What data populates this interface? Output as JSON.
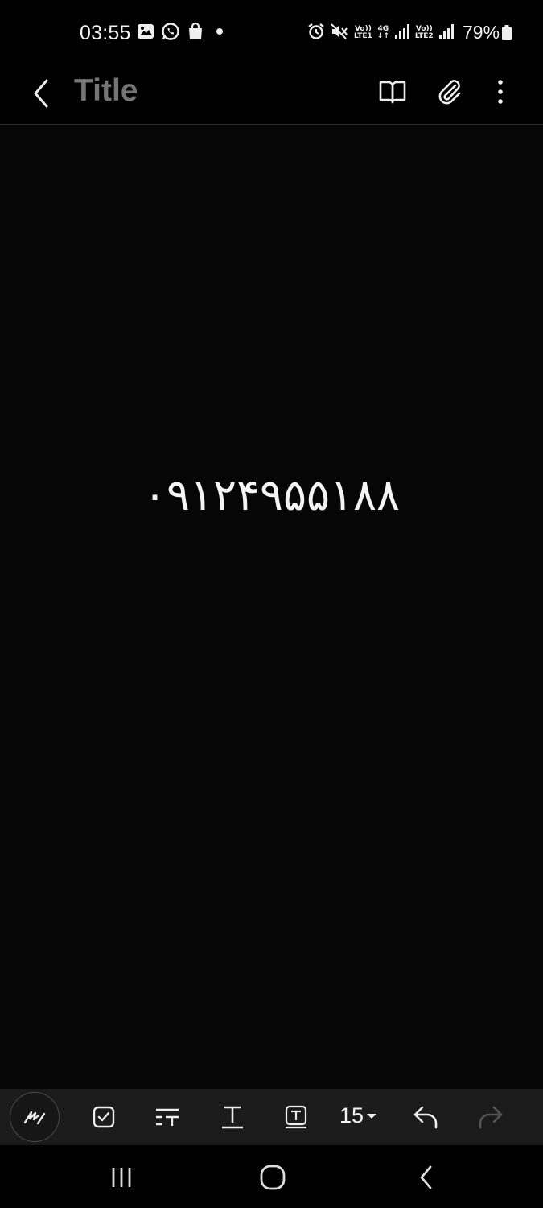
{
  "status_bar": {
    "time": "03:55",
    "left_icons": [
      "gallery-icon",
      "whatsapp-icon",
      "shopping-bag-icon",
      "notification-dot-icon"
    ],
    "right_icons": [
      "alarm-icon",
      "mute-icon",
      "volte-lte1-icon",
      "4g-icon",
      "signal-icon",
      "volte-lte2-icon",
      "signal-icon"
    ],
    "volte1_top": "Vo))",
    "volte1_bottom": "LTE1",
    "network_label": "4G",
    "volte2_top": "Vo))",
    "volte2_bottom": "LTE2",
    "battery_text": "79%"
  },
  "app_bar": {
    "title_placeholder": "Title",
    "actions": [
      "reading-mode-icon",
      "attach-icon",
      "more-options-icon"
    ]
  },
  "note": {
    "text": "۰۹۱۲۴۹۵۵۱۸۸"
  },
  "toolbar": {
    "tools": [
      "handwriting-icon",
      "checkbox-icon",
      "text-style-icon",
      "text-format-icon",
      "text-box-icon"
    ],
    "font_size": "15",
    "undo": "undo-icon",
    "redo": "redo-icon"
  },
  "nav_bar": {
    "buttons": [
      "recent-apps-icon",
      "home-icon",
      "back-icon"
    ]
  },
  "colors": {
    "background": "#060606",
    "bar": "#000000",
    "toolbar": "#1b1b1b",
    "title_placeholder": "#6e6e6e",
    "text": "#f4f4f4"
  }
}
